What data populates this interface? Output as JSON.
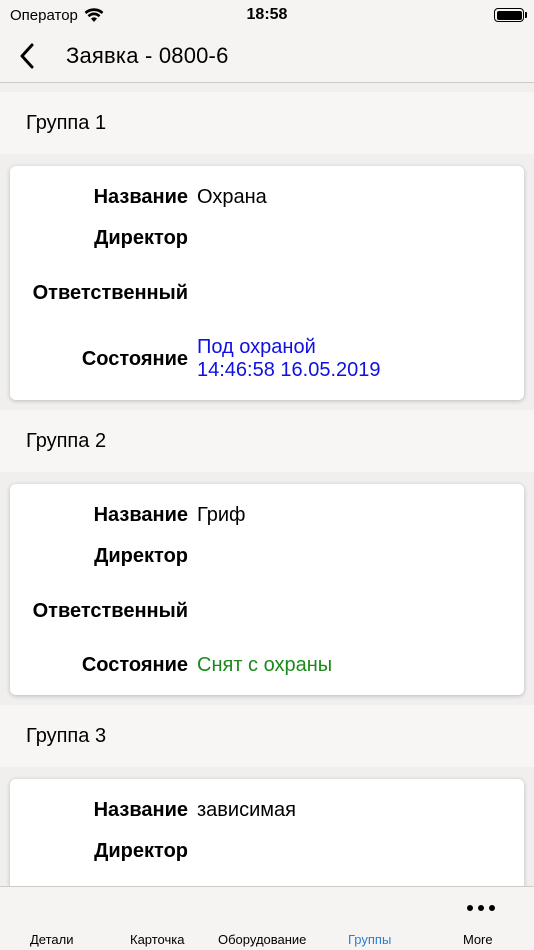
{
  "status_bar": {
    "carrier": "Оператор",
    "time": "18:58"
  },
  "nav": {
    "title": "Заявка - 0800-6"
  },
  "labels": {
    "name": "Название",
    "director": "Директор",
    "responsible": "Ответственный",
    "state": "Состояние"
  },
  "groups": [
    {
      "header": "Группа 1",
      "name": "Охрана",
      "director": "",
      "responsible": "",
      "state_line1": "Под охраной",
      "state_line2": "14:46:58 16.05.2019",
      "state_color": "#1010e0"
    },
    {
      "header": "Группа 2",
      "name": "Гриф",
      "director": "",
      "responsible": "",
      "state_line1": "Снят с охраны",
      "state_color": "#1b8a1b"
    },
    {
      "header": "Группа 3",
      "name": "зависимая",
      "director": "",
      "responsible": ""
    }
  ],
  "tab_bar": {
    "tabs": [
      "Детали",
      "Карточка",
      "Оборудование",
      "Группы",
      "More"
    ],
    "active": "Группы",
    "active_color": "#2a7fd4"
  }
}
